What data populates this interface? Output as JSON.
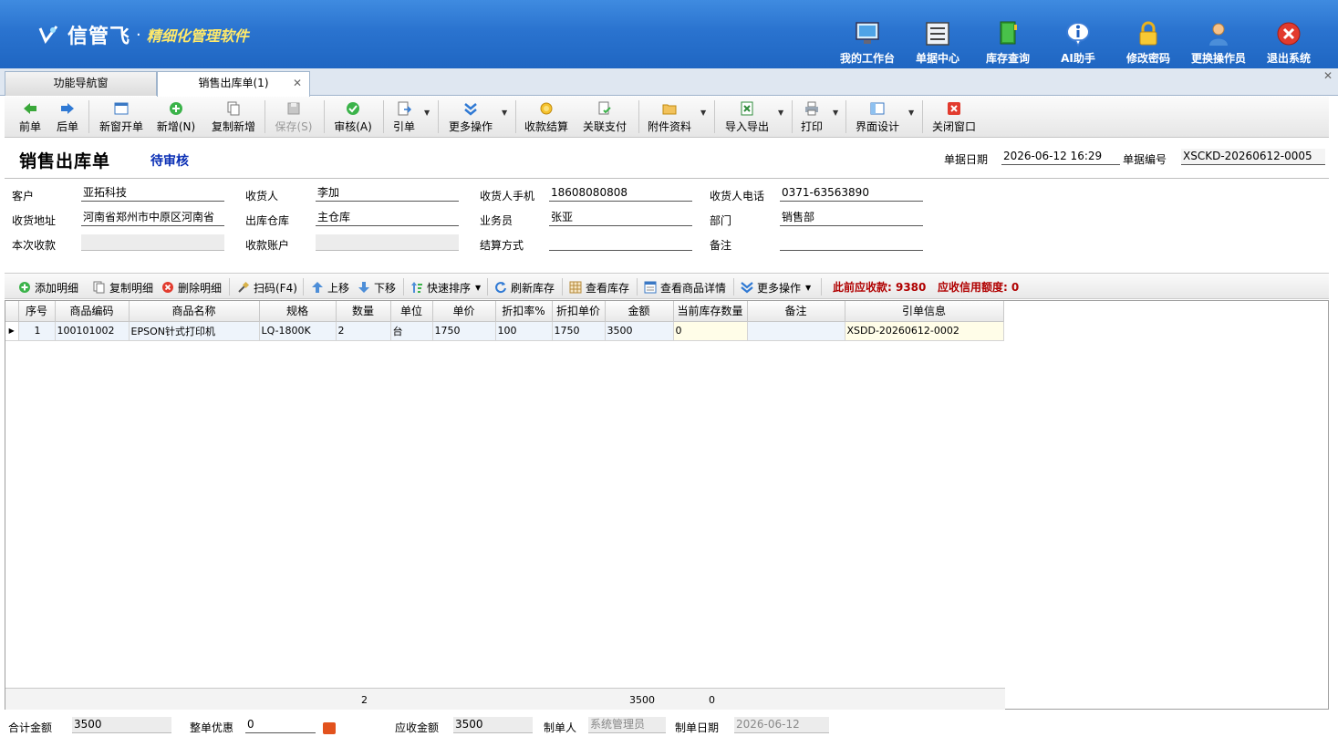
{
  "app": {
    "brand": "信管飞",
    "separator": "·",
    "tagline": "精细化管理软件",
    "top_buttons": [
      {
        "label": "我的工作台",
        "icon": "monitor-icon"
      },
      {
        "label": "单据中心",
        "icon": "document-list-icon"
      },
      {
        "label": "库存查询",
        "icon": "book-icon"
      },
      {
        "label": "AI助手",
        "icon": "info-bubble-icon"
      },
      {
        "label": "修改密码",
        "icon": "lock-icon"
      },
      {
        "label": "更换操作员",
        "icon": "user-icon"
      },
      {
        "label": "退出系统",
        "icon": "close-circle-icon"
      }
    ]
  },
  "tabs": [
    {
      "label": "功能导航窗"
    },
    {
      "label": "销售出库单(1)"
    }
  ],
  "toolbar": {
    "prev": "前单",
    "next": "后单",
    "new_window": "新窗开单",
    "add": "新增(N)",
    "copy_add": "复制新增",
    "save": "保存(S)",
    "approve": "审核(A)",
    "reference": "引单",
    "more": "更多操作",
    "settle": "收款结算",
    "link_pay": "关联支付",
    "attachment": "附件资料",
    "import_export": "导入导出",
    "print": "打印",
    "ui_design": "界面设计",
    "close_window": "关闭窗口"
  },
  "doc": {
    "title": "销售出库单",
    "status": "待审核",
    "date_label": "单据日期",
    "date_value": "2026-06-12 16:29",
    "no_label": "单据编号",
    "no_value": "XSCKD-20260612-0005"
  },
  "form": {
    "customer_label": "客户",
    "customer": "亚拓科技",
    "consignee_label": "收货人",
    "consignee": "李加",
    "mobile_label": "收货人手机",
    "mobile": "18608080808",
    "phone_label": "收货人电话",
    "phone": "0371-63563890",
    "address_label": "收货地址",
    "address": "河南省郑州市中原区河南省",
    "warehouse_label": "出库仓库",
    "warehouse": "主仓库",
    "salesman_label": "业务员",
    "salesman": "张亚",
    "dept_label": "部门",
    "dept": "销售部",
    "receipt_label": "本次收款",
    "receipt": "",
    "account_label": "收款账户",
    "account": "",
    "settle_label": "结算方式",
    "settle": "",
    "remark_label": "备注",
    "remark": ""
  },
  "detail_toolbar": {
    "add": "添加明细",
    "copy": "复制明细",
    "delete": "删除明细",
    "scan": "扫码(F4)",
    "up": "上移",
    "down": "下移",
    "sort": "快速排序",
    "refresh": "刷新库存",
    "stock": "查看库存",
    "detail": "查看商品详情",
    "more": "更多操作",
    "receivable": "此前应收款: 9380",
    "credit": "应收信用额度: 0"
  },
  "grid": {
    "columns": [
      "序号",
      "商品编码",
      "商品名称",
      "规格",
      "数量",
      "单位",
      "单价",
      "折扣率%",
      "折扣单价",
      "金额",
      "当前库存数量",
      "备注",
      "引单信息"
    ],
    "rows": [
      [
        "1",
        "100101002",
        "EPSON针式打印机",
        "LQ-1800K",
        "2",
        "台",
        "1750",
        "100",
        "1750",
        "3500",
        "0",
        "",
        "XSDD-20260612-0002"
      ]
    ],
    "sum_qty": "2",
    "sum_amount": "3500",
    "sum_stock": "0"
  },
  "footer": {
    "total_label": "合计金额",
    "total": "3500",
    "discount_label": "整单优惠",
    "discount": "0",
    "receivable_label": "应收金额",
    "receivable": "3500",
    "maker_label": "制单人",
    "maker": "系统管理员",
    "make_date_label": "制单日期",
    "make_date": "2026-06-12"
  },
  "colors": {
    "accent": "#2a73cf",
    "status": "#0a2fb5",
    "warn": "#b00000"
  }
}
